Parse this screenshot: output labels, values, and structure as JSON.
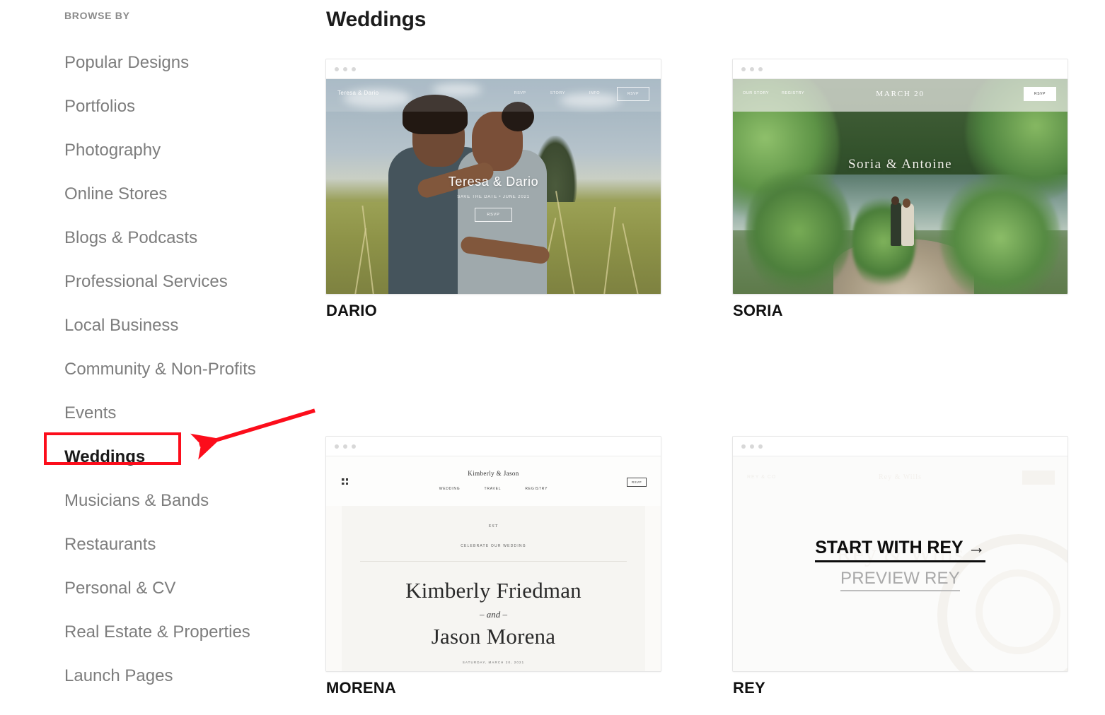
{
  "sidebar": {
    "heading": "BROWSE BY",
    "items": [
      {
        "label": "Popular Designs",
        "active": false
      },
      {
        "label": "Portfolios",
        "active": false
      },
      {
        "label": "Photography",
        "active": false
      },
      {
        "label": "Online Stores",
        "active": false
      },
      {
        "label": "Blogs & Podcasts",
        "active": false
      },
      {
        "label": "Professional Services",
        "active": false
      },
      {
        "label": "Local Business",
        "active": false
      },
      {
        "label": "Community & Non-Profits",
        "active": false
      },
      {
        "label": "Events",
        "active": false
      },
      {
        "label": "Weddings",
        "active": true
      },
      {
        "label": "Musicians & Bands",
        "active": false
      },
      {
        "label": "Restaurants",
        "active": false
      },
      {
        "label": "Personal & CV",
        "active": false
      },
      {
        "label": "Real Estate & Properties",
        "active": false
      },
      {
        "label": "Launch Pages",
        "active": false
      }
    ]
  },
  "annotation": {
    "highlight_color": "#fc0d1b",
    "target_label": "Weddings"
  },
  "main": {
    "title": "Weddings",
    "templates": [
      {
        "name": "DARIO",
        "preview": {
          "brand": "Teresa & Dario",
          "nav": [
            "RSVP",
            "STORY",
            "INFO"
          ],
          "cta": "RSVP",
          "hero_names": "Teresa & Dario",
          "hero_sub": "SAVE THE DATE  •  JUNE 2021",
          "hero_button": "RSVP"
        }
      },
      {
        "name": "SORIA",
        "preview": {
          "nav": [
            "OUR STORY",
            "REGISTRY"
          ],
          "date": "MARCH 20",
          "cta": "RSVP",
          "hero_names": "Soria & Antoine"
        }
      },
      {
        "name": "MORENA",
        "preview": {
          "brand": "Kimberly & Jason",
          "nav": [
            "WEDDING",
            "TRAVEL",
            "REGISTRY"
          ],
          "cta": "RSVP",
          "eyebrow": "EST",
          "sub": "CELEBRATE OUR WEDDING",
          "name_first": "Kimberly Friedman",
          "and": "– and –",
          "name_second": "Jason Morena",
          "date": "SATURDAY, MARCH 20, 2021"
        }
      },
      {
        "name": "REY",
        "preview": {
          "brand": "REY & CO",
          "mid": "Rey & Wills",
          "ghost": "Rey & Wills"
        },
        "hover": {
          "start_label": "START WITH REY →",
          "preview_label": "PREVIEW REY"
        }
      }
    ]
  }
}
